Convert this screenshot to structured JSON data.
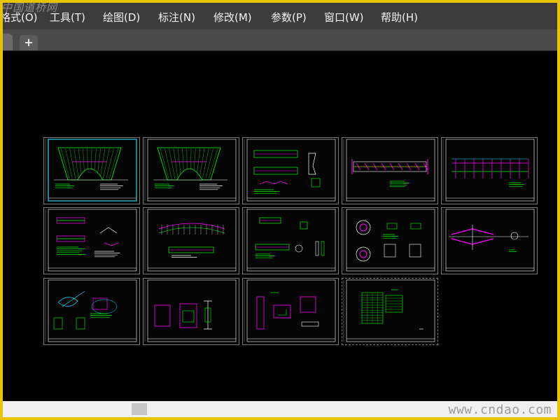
{
  "watermark": {
    "top": "中国道桥网",
    "bottom": "www.cndao.com"
  },
  "menubar": {
    "items": [
      "格式(O)",
      "工具(T)",
      "绘图(D)",
      "标注(N)",
      "修改(M)",
      "参数(P)",
      "窗口(W)",
      "帮助(H)"
    ]
  },
  "tabs": {
    "new_tab_label": "+"
  },
  "layout_sheets": [
    {
      "drawing": "arch-front-elevation",
      "selected": true
    },
    {
      "drawing": "arch-front-elevation"
    },
    {
      "drawing": "beam-plan-detail"
    },
    {
      "drawing": "long-deck-elevation"
    },
    {
      "drawing": "pier-frame-elevation"
    },
    {
      "drawing": "rebar-blocks"
    },
    {
      "drawing": "arch-girder"
    },
    {
      "drawing": "section-details"
    },
    {
      "drawing": "node-circles"
    },
    {
      "drawing": "cable-node"
    },
    {
      "drawing": "joint-details"
    },
    {
      "drawing": "magenta-sections"
    },
    {
      "drawing": "box-sections"
    },
    {
      "drawing": "quantity-table"
    }
  ],
  "colors": {
    "page_border": "#e8c400",
    "menubar_bg": "#3c3c3c",
    "canvas_bg": "#000000",
    "cad_green": "#00ff00",
    "cad_magenta": "#ff00ff",
    "cad_cyan": "#00e5ff",
    "cad_yellow": "#ffff00",
    "cad_white": "#ffffff",
    "selection_cyan": "#2bd6e6"
  }
}
